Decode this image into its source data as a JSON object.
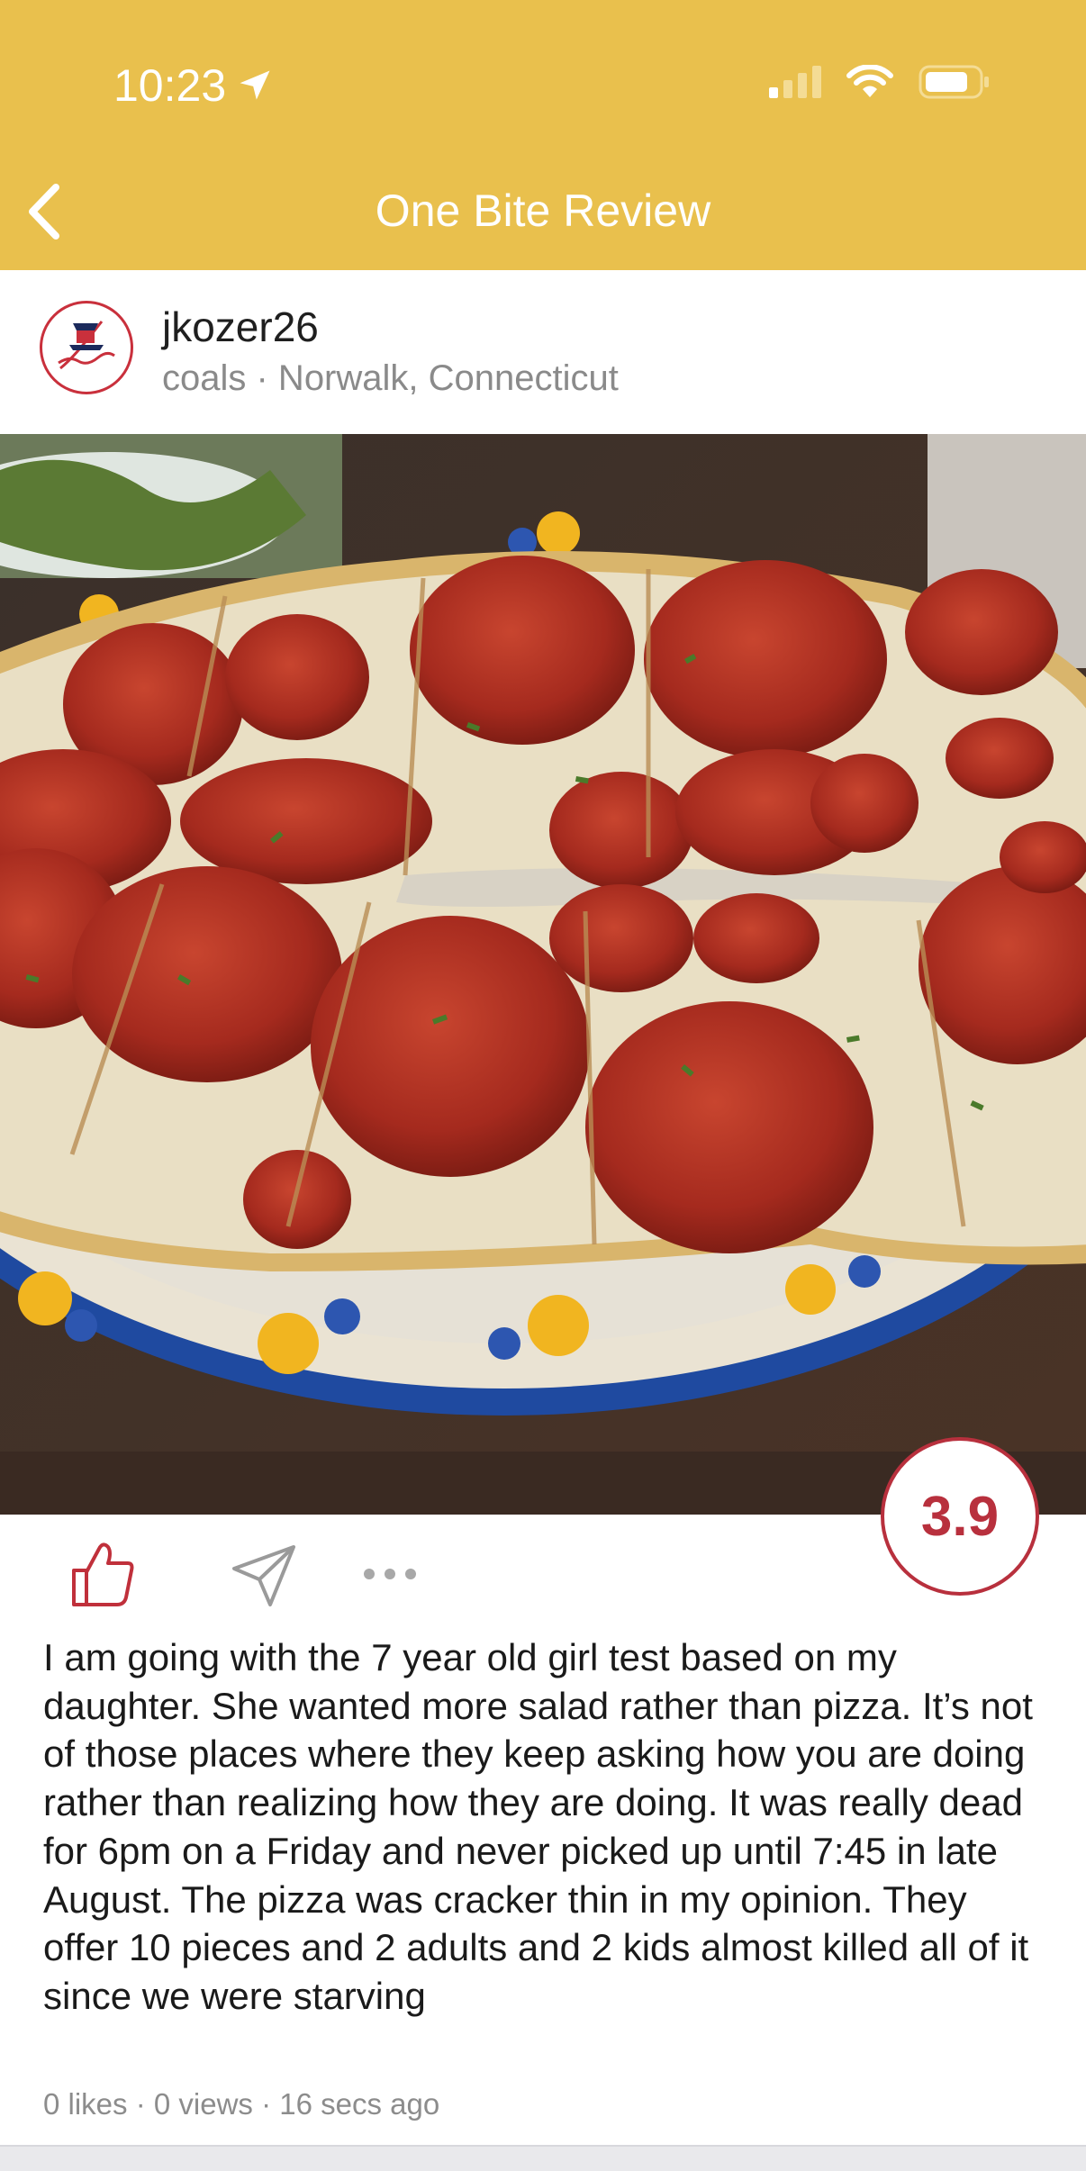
{
  "status_bar": {
    "time": "10:23"
  },
  "nav": {
    "title": "One Bite Review"
  },
  "post": {
    "username": "jkozer26",
    "location": "coals · Norwalk, Connecticut",
    "score": "3.9",
    "review": "I am going with the 7 year old girl test based on my daughter. She wanted more salad rather than pizza. It’s not of those places where they keep asking how you are doing rather than realizing how they are doing. It was really dead for 6pm on a Friday and never picked up until 7:45 in late August. The pizza was cracker thin in my opinion. They offer 10 pieces and 2 adults and 2 kids almost killed all of it since we were starving",
    "meta": "0 likes · 0 views · 16 secs ago"
  },
  "colors": {
    "header": "#e9c04d",
    "accent": "#b8303d"
  },
  "icons": [
    "location-arrow-icon",
    "signal-icon",
    "wifi-icon",
    "battery-icon",
    "back-chevron-icon",
    "thumbs-up-icon",
    "send-icon",
    "more-icon"
  ]
}
